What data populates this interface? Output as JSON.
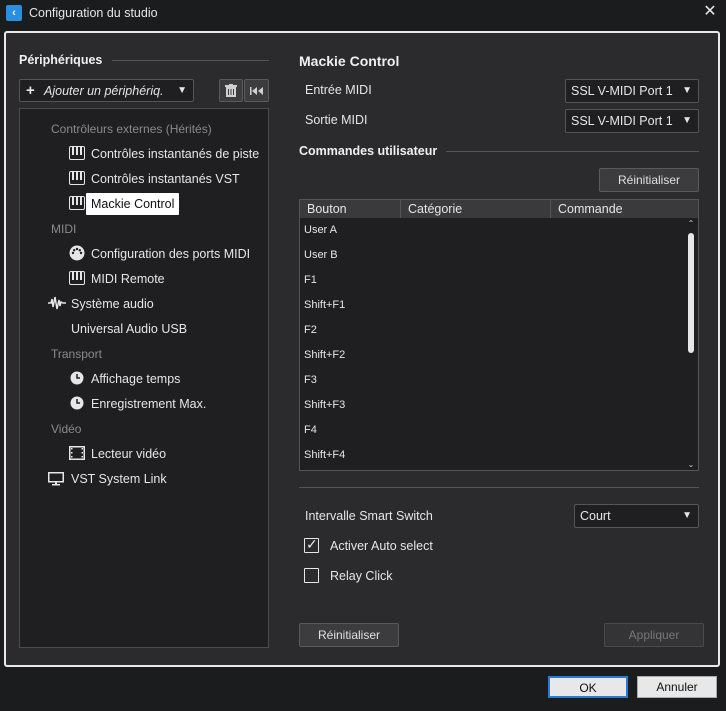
{
  "window": {
    "title": "Configuration du studio",
    "close": "✕"
  },
  "left": {
    "title": "Périphériques",
    "add_select": "Ajouter un périphériq.",
    "tree": {
      "cat_external": "Contrôleurs externes (Hérités)",
      "item_track_quick": "Contrôles instantanés de piste",
      "item_vst_quick": "Contrôles instantanés VST",
      "item_mackie": "Mackie Control",
      "cat_midi": "MIDI",
      "item_midi_ports": "Configuration des ports MIDI",
      "item_midi_remote": "MIDI Remote",
      "item_audio_system": "Système audio",
      "item_ua_usb": "Universal Audio USB",
      "cat_transport": "Transport",
      "item_time_display": "Affichage temps",
      "item_max_record": "Enregistrement Max.",
      "cat_video": "Vidéo",
      "item_video_player": "Lecteur vidéo",
      "item_vst_system_link": "VST System Link"
    }
  },
  "right": {
    "title": "Mackie Control",
    "midi_in_label": "Entrée MIDI",
    "midi_in_value": "SSL V-MIDI Port 1",
    "midi_out_label": "Sortie MIDI",
    "midi_out_value": "SSL V-MIDI Port 1",
    "user_cmds_title": "Commandes utilisateur",
    "reset_top": "Réinitialiser",
    "table": {
      "headers": [
        "Bouton",
        "Catégorie",
        "Commande"
      ],
      "rows": [
        "User A",
        "User B",
        "F1",
        "Shift+F1",
        "F2",
        "Shift+F2",
        "F3",
        "Shift+F3",
        "F4",
        "Shift+F4"
      ]
    },
    "smart_switch_label": "Intervalle Smart Switch",
    "smart_switch_value": "Court",
    "auto_select_label": "Activer Auto select",
    "auto_select_checked": true,
    "relay_click_label": "Relay Click",
    "relay_click_checked": false,
    "reset_bottom": "Réinitialiser",
    "apply": "Appliquer"
  },
  "footer": {
    "ok": "OK",
    "cancel": "Annuler"
  },
  "colors": {
    "background": "#2b2b2d",
    "panel": "#1f1f21",
    "accent": "#2a7ad8",
    "text": "#e6e6e6"
  },
  "icons": [
    "cubase-icon",
    "plus-icon",
    "trash-icon",
    "rewind-icon",
    "midi-keyboard-icon",
    "midi-port-icon",
    "waveform-icon",
    "clock-icon",
    "film-icon",
    "monitor-icon",
    "chevron-down-icon",
    "check-icon"
  ]
}
